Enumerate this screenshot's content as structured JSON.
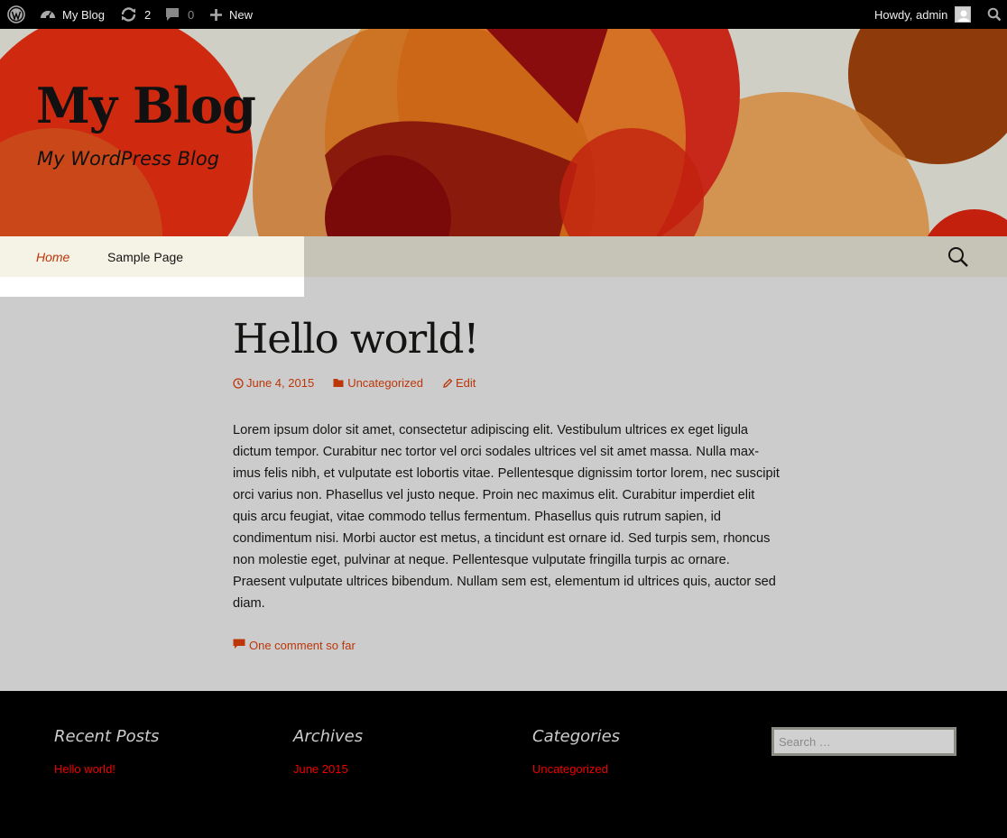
{
  "admin_bar": {
    "site_name": "My Blog",
    "updates_count": "2",
    "comments_count": "0",
    "new_label": "New",
    "greeting": "Howdy, admin"
  },
  "header": {
    "site_title": "My Blog",
    "site_description": "My WordPress Blog"
  },
  "nav": {
    "items": [
      {
        "label": "Home",
        "current": true
      },
      {
        "label": "Sample Page",
        "current": false
      }
    ]
  },
  "post": {
    "title": "Hello world!",
    "date": "June 4, 2015",
    "category": "Uncategorized",
    "edit_label": "Edit",
    "body": "Lorem ipsum dolor sit amet, consectetur adipiscing elit. Vestibulum ultrices ex eget ligula dictum tempor. Curabitur nec tortor vel orci sodales ultrices vel sit amet massa. Nulla max­imus felis nibh, et vulputate est lobortis vitae. Pellentesque dignissim tortor lorem, nec suscipit orci varius non. Phasellus vel justo neque. Proin nec maximus elit. Curabitur im­perdiet elit quis arcu feugiat, vitae commodo tellus fermentum. Phasellus quis rutrum sapien, id condimentum nisi. Morbi auctor est metus, a tincidunt est ornare id. Sed turpis sem, rhoncus non molestie eget, pulvinar at neque. Pellentesque vulputate fringilla turpis ac ornare. Praesent vulputate ultrices bibendum. Nullam sem est, elementum id ultrices quis, auctor sed diam.",
    "comments_link": "One comment so far"
  },
  "footer": {
    "widgets": [
      {
        "title": "Recent Posts",
        "link": "Hello world!"
      },
      {
        "title": "Archives",
        "link": "June 2015"
      },
      {
        "title": "Categories",
        "link": "Uncategorized"
      }
    ],
    "search_placeholder": "Search …"
  },
  "colors": {
    "accent": "#bc360a",
    "footer_link": "#ee0000",
    "admin_bar_bg": "#000000",
    "nav_bg": "#c6c4b7",
    "content_bg": "#cccccc"
  },
  "icons": {
    "admin_bar": [
      "wordpress-icon",
      "dashboard-icon",
      "updates-icon",
      "comment-bubble-icon",
      "plus-icon",
      "admin-search-icon"
    ],
    "meta": [
      "clock-icon",
      "folder-icon",
      "pencil-icon",
      "comment-icon"
    ],
    "nav": [
      "search-icon"
    ]
  }
}
